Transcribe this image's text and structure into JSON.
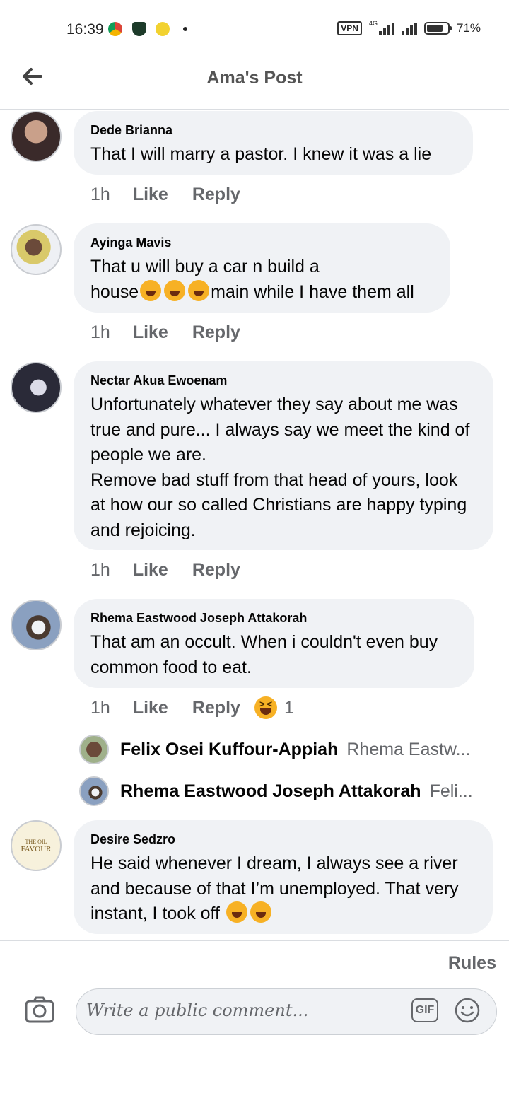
{
  "status_bar": {
    "time": "16:39",
    "vpn": "VPN",
    "network": "4G",
    "battery": "71%",
    "battery_level": 0.71
  },
  "header": {
    "title": "Ama's Post",
    "back_icon": "arrow-left-icon"
  },
  "comments": [
    {
      "name": "Dede Brianna",
      "text": "That I will marry a pastor. I knew it was a lie",
      "time": "1h",
      "like": "Like",
      "reply": "Reply",
      "avatar_color": "#5a4a4a"
    },
    {
      "name": "Ayinga Mavis",
      "text_1": "That u will buy a car n build a",
      "text_2a": "house",
      "text_2b": "main while I have them all",
      "time": "1h",
      "like": "Like",
      "reply": "Reply",
      "avatar_color": "#d9c96a"
    },
    {
      "name": "Nectar Akua Ewoenam",
      "text": "Unfortunately whatever they say about me was true and pure... I always say we meet the kind of people we are.\nRemove bad stuff from that head of yours, look at how our so called Christians are happy typing and rejoicing.",
      "time": "1h",
      "like": "Like",
      "reply": "Reply",
      "avatar_color": "#2a2a38"
    },
    {
      "name": "Rhema Eastwood Joseph Attakorah",
      "text": "That am an occult. When i couldn't even buy common food to eat.",
      "time": "1h",
      "like": "Like",
      "reply": "Reply",
      "reaction_count": "1",
      "avatar_color": "#8aa0c0"
    },
    {
      "name": "Desire Sedzro",
      "text_a": "He said whenever I dream, I always see a river and because of that I’m unemployed. That very instant, I took off ",
      "avatar_text_1": "THE OIL",
      "avatar_text_2": "FAVOUR",
      "avatar_color": "#e8c85a"
    }
  ],
  "replies": [
    {
      "name": "Felix Osei Kuffour-Appiah",
      "snippet": "Rhema Eastw...",
      "avatar_color": "#6b4a3a"
    },
    {
      "name": "Rhema Eastwood Joseph Attakorah",
      "snippet": "Feli...",
      "avatar_color": "#8aa0c0"
    }
  ],
  "footer": {
    "rules": "Rules",
    "placeholder": "Write a public comment...",
    "gif": "GIF"
  }
}
